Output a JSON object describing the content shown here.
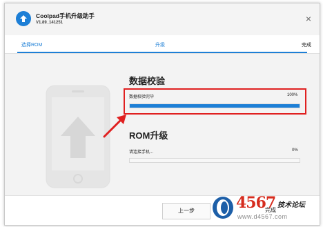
{
  "window": {
    "title": "Coolpad手机升级助手",
    "version": "V1.89_141251",
    "close_glyph": "×"
  },
  "steps": [
    {
      "label": "选择ROM",
      "state": "done"
    },
    {
      "label": "升级",
      "state": "active"
    },
    {
      "label": "完成",
      "state": "pending"
    }
  ],
  "verify": {
    "title": "数据校验",
    "status": "数据校验完毕",
    "percent_text": "100%",
    "progress": 1.0
  },
  "rom_upgrade": {
    "title": "ROM升级",
    "status": "请连接手机...",
    "percent_text": "0%",
    "progress": 0.0
  },
  "footer": {
    "prev_label": "上一步",
    "finish_label": "完成"
  },
  "watermark": {
    "digits": "4567",
    "text": "技术论坛",
    "url": "www.d4567.com"
  },
  "colors": {
    "accent": "#1d7fd6",
    "highlight": "#e02020",
    "content_bg": "#f3f3f3",
    "watermark_red": "#d62c1e"
  }
}
